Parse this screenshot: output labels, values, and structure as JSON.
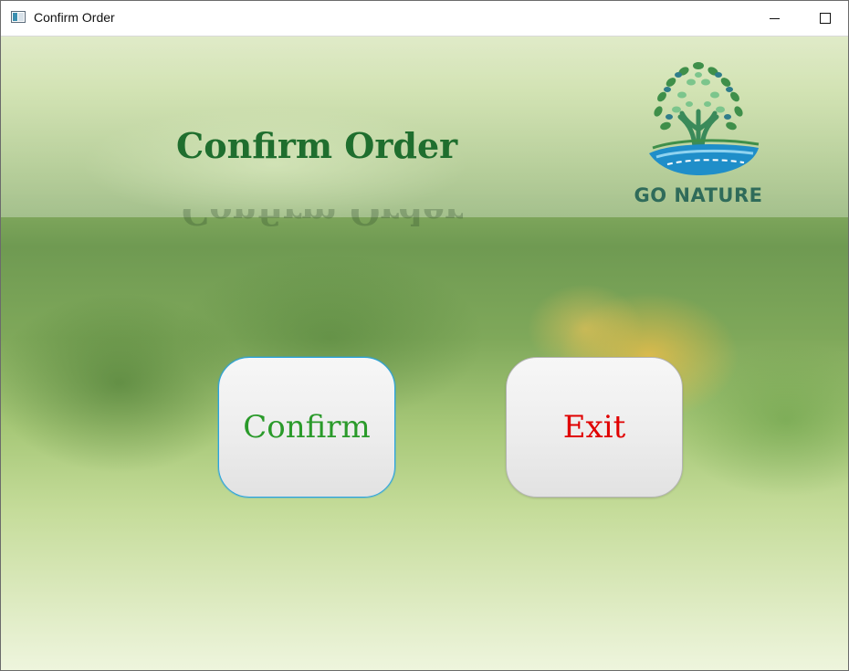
{
  "window": {
    "title": "Confirm Order",
    "minimize_icon": "minimize-icon",
    "maximize_icon": "maximize-icon",
    "app_icon": "window-app-icon"
  },
  "header": {
    "title": "Confirm Order",
    "logo_text": "GO NATURE"
  },
  "actions": {
    "confirm_label": "Confirm",
    "exit_label": "Exit"
  },
  "colors": {
    "title": "#1f6e2e",
    "confirm_text": "#2a9a2a",
    "exit_text": "#e00000",
    "focus_border": "#2aa3e0",
    "logo_blue": "#1f8ec9",
    "logo_green": "#3f8f4a"
  }
}
